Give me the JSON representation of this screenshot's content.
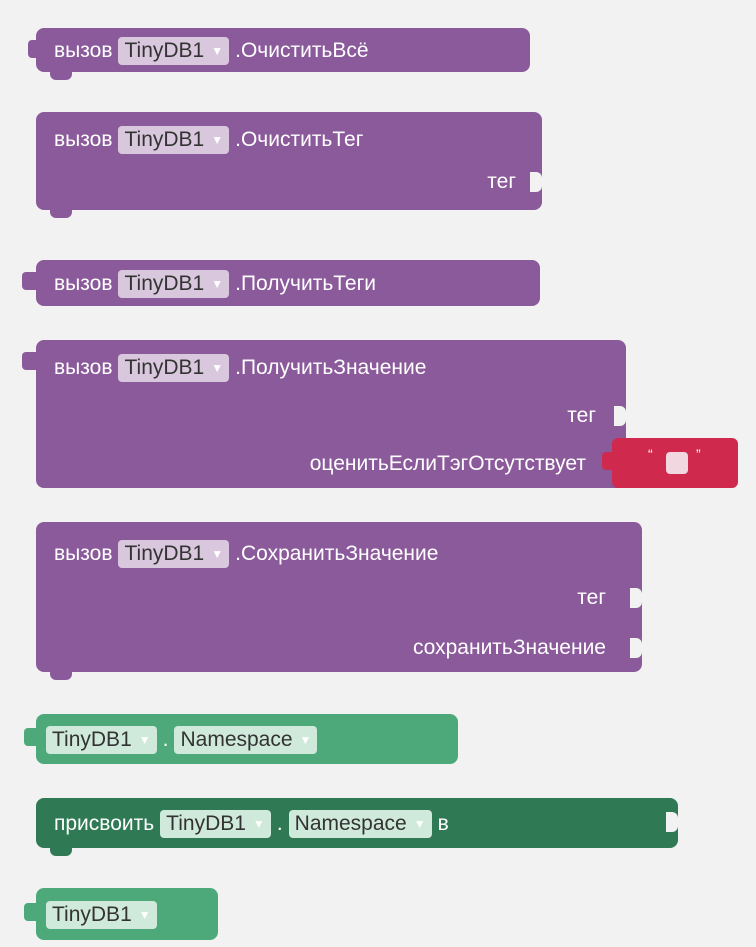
{
  "blocks": {
    "clear_all": {
      "prefix": "вызов",
      "component": "TinyDB1",
      "method": ".ОчиститьВсё"
    },
    "clear_tag": {
      "prefix": "вызов",
      "component": "TinyDB1",
      "method": ".ОчиститьТег",
      "arg_tag": "тег"
    },
    "get_tags": {
      "prefix": "вызов",
      "component": "TinyDB1",
      "method": ".ПолучитьТеги"
    },
    "get_value": {
      "prefix": "вызов",
      "component": "TinyDB1",
      "method": ".ПолучитьЗначение",
      "arg_tag": "тег",
      "arg_default": "оценитьЕслиТэгОтсутствует",
      "default_quote_open": "“",
      "default_quote_close": "”"
    },
    "store_value": {
      "prefix": "вызов",
      "component": "TinyDB1",
      "method": ".СохранитьЗначение",
      "arg_tag": "тег",
      "arg_value": "сохранитьЗначение"
    },
    "namespace_get": {
      "component": "TinyDB1",
      "dot": ".",
      "property": "Namespace"
    },
    "namespace_set": {
      "prefix": "присвоить",
      "component": "TinyDB1",
      "dot": ".",
      "property": "Namespace",
      "suffix": "в"
    },
    "component_ref": {
      "component": "TinyDB1"
    }
  },
  "colors": {
    "procedure": "#8b5a9b",
    "getter": "#4ea97a",
    "setter": "#2f7a55",
    "text": "#cf2a4e",
    "background": "#f2f2f2"
  },
  "icons": {
    "dropdown": "dropdown-triangle-icon"
  }
}
